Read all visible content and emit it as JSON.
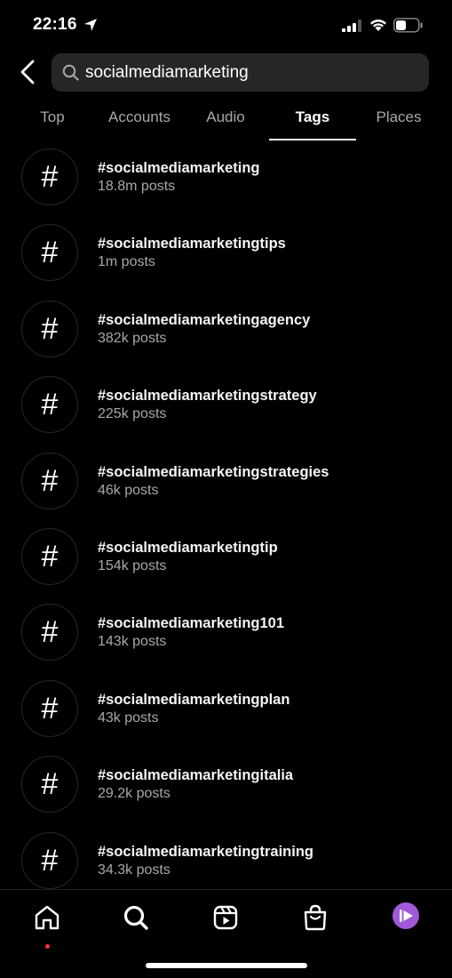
{
  "status_bar": {
    "time": "22:16"
  },
  "search": {
    "value": "socialmediamarketing",
    "placeholder": "Search"
  },
  "tabs": [
    {
      "label": "Top"
    },
    {
      "label": "Accounts"
    },
    {
      "label": "Audio"
    },
    {
      "label": "Tags"
    },
    {
      "label": "Places"
    }
  ],
  "active_tab": "Tags",
  "results": [
    {
      "icon": "#",
      "name": "#socialmediamarketing",
      "count": "18.8m posts"
    },
    {
      "icon": "#",
      "name": "#socialmediamarketingtips",
      "count": "1m posts"
    },
    {
      "icon": "#",
      "name": "#socialmediamarketingagency",
      "count": "382k posts"
    },
    {
      "icon": "#",
      "name": "#socialmediamarketingstrategy",
      "count": "225k posts"
    },
    {
      "icon": "#",
      "name": "#socialmediamarketingstrategies",
      "count": "46k posts"
    },
    {
      "icon": "#",
      "name": "#socialmediamarketingtip",
      "count": "154k posts"
    },
    {
      "icon": "#",
      "name": "#socialmediamarketing101",
      "count": "143k posts"
    },
    {
      "icon": "#",
      "name": "#socialmediamarketingplan",
      "count": "43k posts"
    },
    {
      "icon": "#",
      "name": "#socialmediamarketingitalia",
      "count": "29.2k posts"
    },
    {
      "icon": "#",
      "name": "#socialmediamarketingtraining",
      "count": "34.3k posts"
    }
  ],
  "bottom_nav": [
    {
      "icon": "home-icon"
    },
    {
      "icon": "search-icon"
    },
    {
      "icon": "reels-icon"
    },
    {
      "icon": "shop-icon"
    },
    {
      "icon": "profile-avatar"
    }
  ],
  "colors": {
    "background": "#000000",
    "secondary_text": "#a8a8a8",
    "search_bg": "#262626",
    "notification": "#ff3040",
    "avatar": "#a259d9"
  }
}
